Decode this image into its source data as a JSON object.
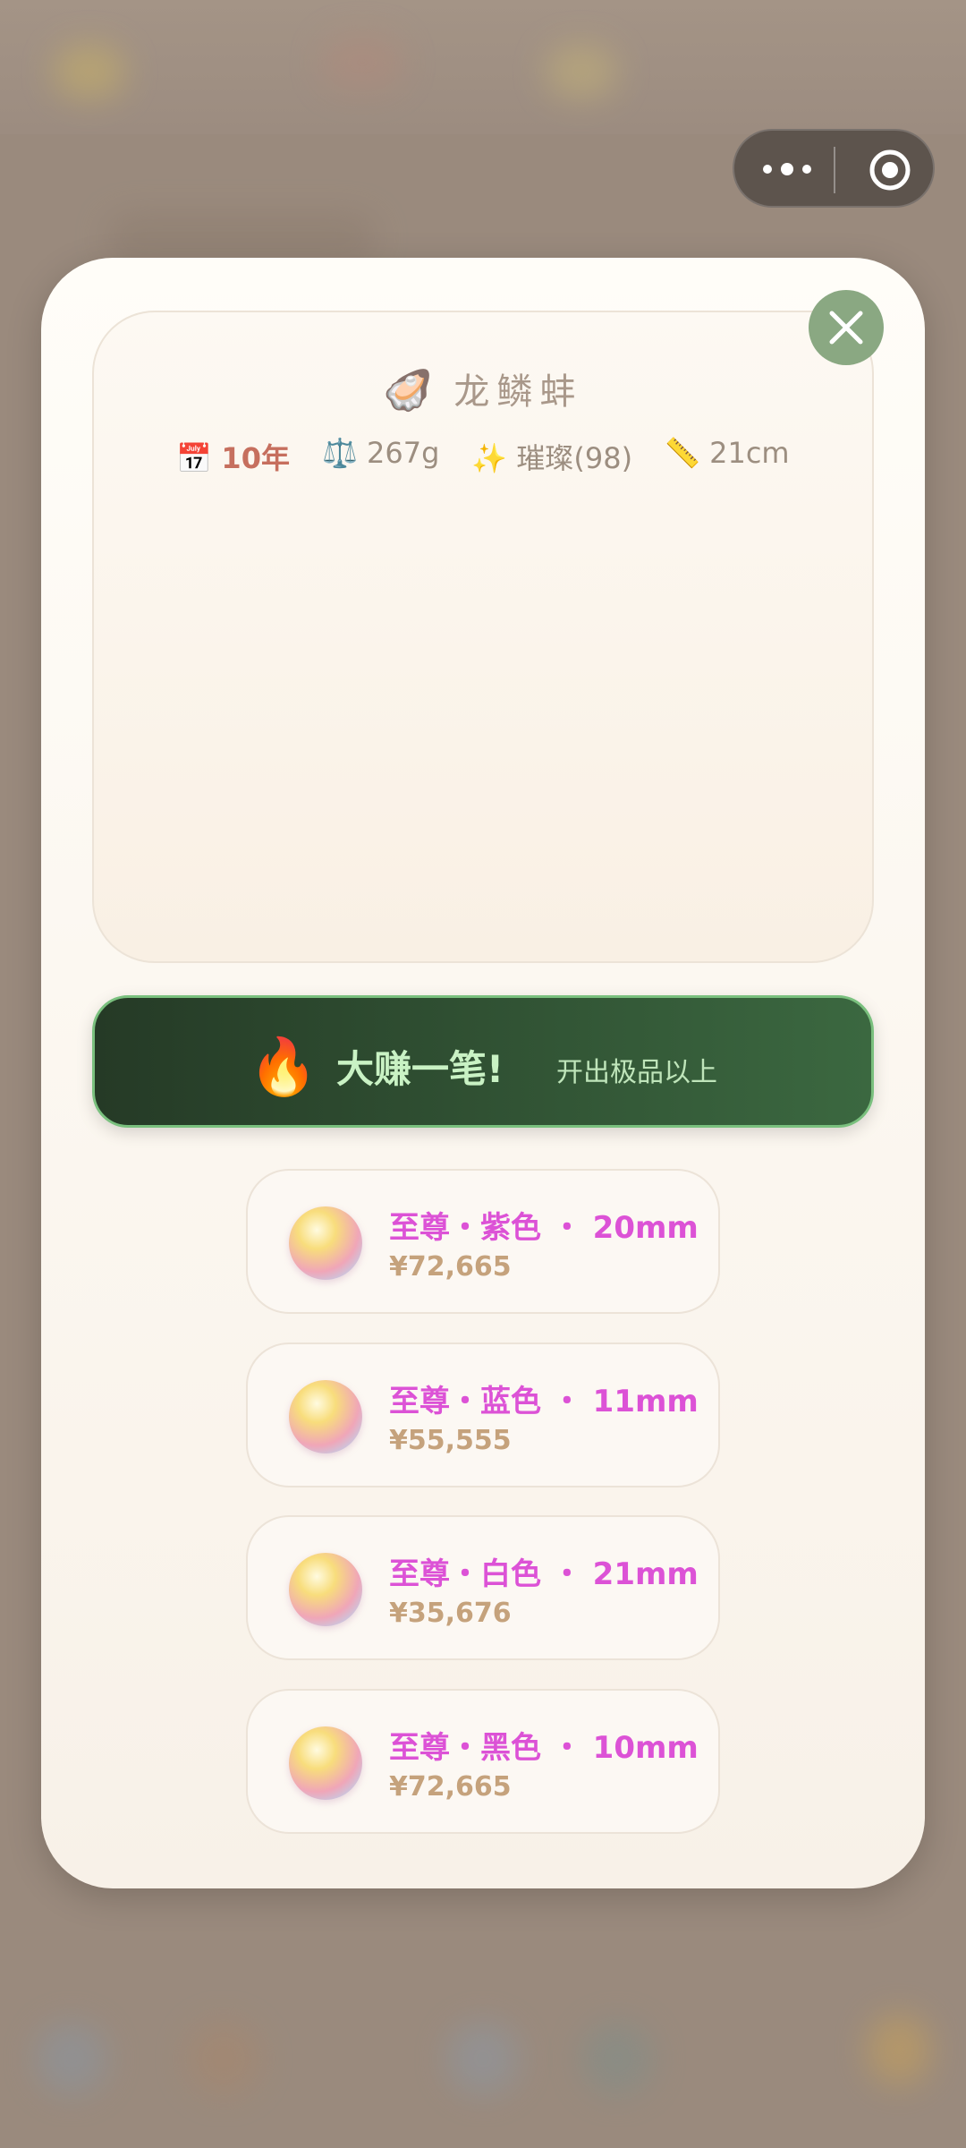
{
  "capsule": {
    "more_label": "•••",
    "target_label": "◎"
  },
  "close": {
    "icon": "close-icon"
  },
  "clam": {
    "icon": "🦪",
    "name": "龙鳞蚌",
    "meta": {
      "age_icon": "📅",
      "age": "10年",
      "weight_icon": "⚖️",
      "weight": "267g",
      "luster_icon": "✨",
      "luster": "璀璨(98)",
      "size_icon": "📏",
      "size": "21cm"
    }
  },
  "banner": {
    "icon": "🔥",
    "headline": "大赚一笔!",
    "subtitle": "开出极品以上"
  },
  "pearls": [
    {
      "name": "至尊・紫色 ・ 20mm",
      "price": "¥72,665"
    },
    {
      "name": "至尊・蓝色 ・ 11mm",
      "price": "¥55,555"
    },
    {
      "name": "至尊・白色 ・ 21mm",
      "price": "¥35,676"
    },
    {
      "name": "至尊・黑色 ・ 10mm",
      "price": "¥72,665"
    }
  ],
  "colors": {
    "accent_green": "#8aa882",
    "pearl_name": "#dc52d6",
    "price": "#c5a27c",
    "years": "#c66f5e"
  }
}
